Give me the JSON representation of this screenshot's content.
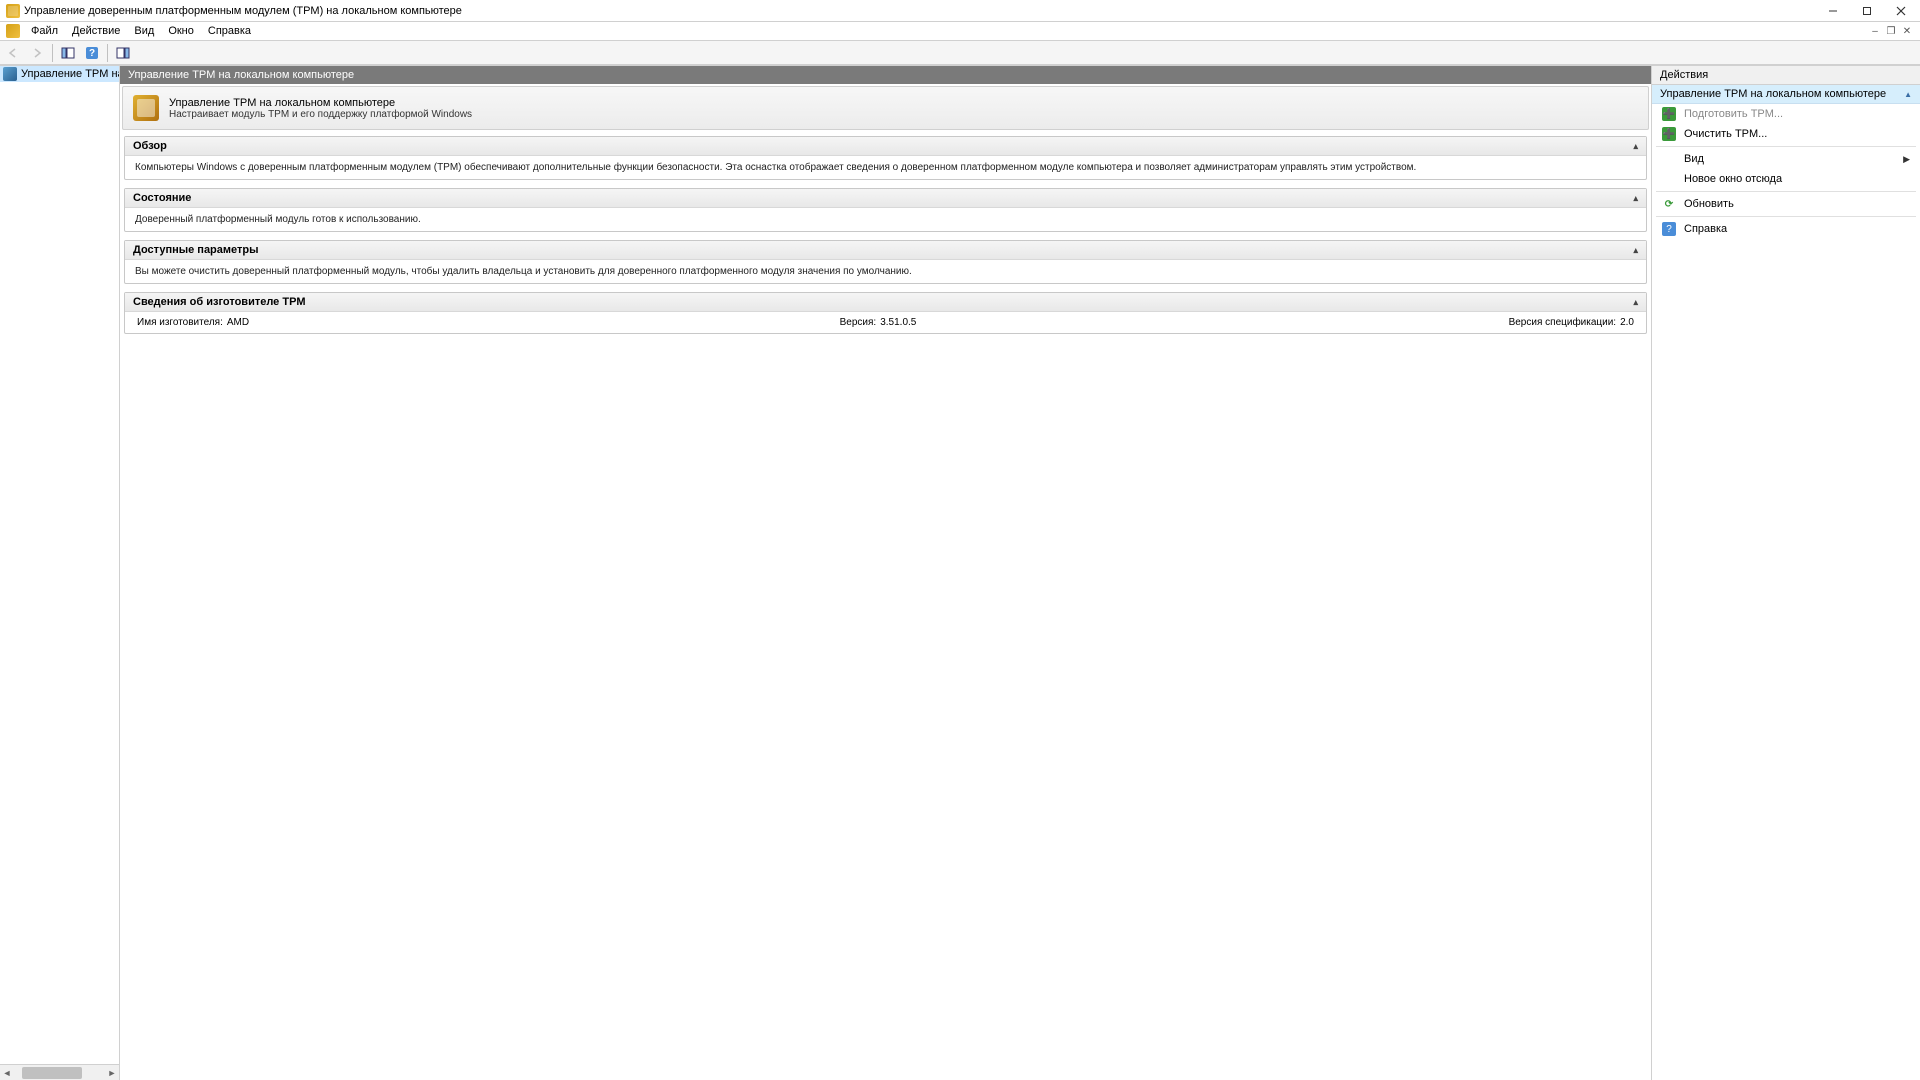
{
  "window": {
    "title": "Управление доверенным платформенным модулем (TPM) на локальном компьютере"
  },
  "menu": {
    "file": "Файл",
    "action": "Действие",
    "view": "Вид",
    "window": "Окно",
    "help": "Справка"
  },
  "tree": {
    "item": "Управление TPM на локальном к"
  },
  "center": {
    "header": "Управление TPM на локальном компьютере",
    "info_line1": "Управление TPM на локальном компьютере",
    "info_line2": "Настраивает модуль TPM и его поддержку платформой Windows"
  },
  "sections": {
    "overview": {
      "title": "Обзор",
      "body": "Компьютеры Windows с доверенным платформенным модулем (TPM) обеспечивают дополнительные функции безопасности. Эта оснастка отображает сведения о доверенном платформенном модуле компьютера и позволяет администраторам управлять этим устройством."
    },
    "status": {
      "title": "Состояние",
      "body": "Доверенный платформенный модуль готов к использованию."
    },
    "options": {
      "title": "Доступные параметры",
      "body": "Вы можете очистить доверенный платформенный модуль, чтобы удалить владельца и установить для доверенного платформенного модуля значения по умолчанию."
    },
    "manuf": {
      "title": "Сведения об изготовителе TPM",
      "name_label": "Имя изготовителя:",
      "name_val": "AMD",
      "ver_label": "Версия:",
      "ver_val": "3.51.0.5",
      "spec_label": "Версия спецификации:",
      "spec_val": "2.0"
    }
  },
  "actions": {
    "header": "Действия",
    "group": "Управление TPM на локальном компьютере",
    "prepare": "Подготовить TPM...",
    "clear": "Очистить TPM...",
    "view": "Вид",
    "newwin": "Новое окно отсюда",
    "refresh": "Обновить",
    "help": "Справка"
  }
}
